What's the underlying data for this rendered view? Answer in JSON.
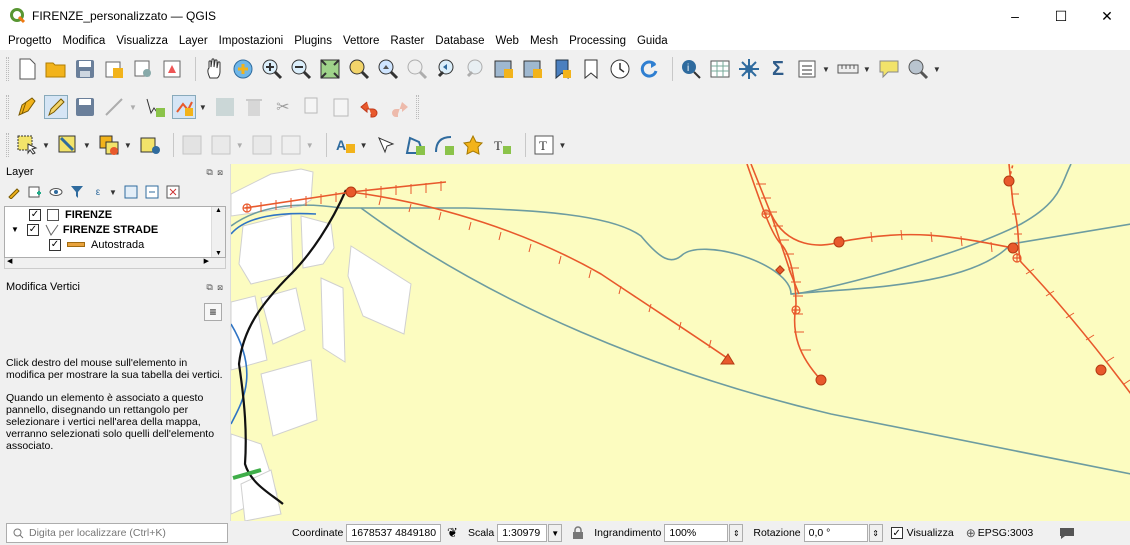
{
  "window": {
    "title": "FIRENZE_personalizzato — QGIS",
    "minimize": "–",
    "maximize": "☐",
    "close": "✕"
  },
  "menu": [
    "Progetto",
    "Modifica",
    "Visualizza",
    "Layer",
    "Impostazioni",
    "Plugins",
    "Vettore",
    "Raster",
    "Database",
    "Web",
    "Mesh",
    "Processing",
    "Guida"
  ],
  "layers_panel": {
    "title": "Layer",
    "layers": [
      {
        "name": "FIRENZE",
        "checked": true
      },
      {
        "name": "FIRENZE STRADE",
        "checked": true
      },
      {
        "name": "Autostrada",
        "checked": true
      }
    ]
  },
  "vertex_panel": {
    "title": "Modifica Vertici",
    "paragraph1": "Click destro del mouse sull'elemento in modifica per mostrare la sua tabella dei vertici.",
    "paragraph2": "Quando un elemento è associato a questo pannello, disegnando un rettangolo per selezionare i vertici nell'area della mappa, verranno selezionati solo quelli dell'elemento associato."
  },
  "status": {
    "locator_placeholder": "Digita per localizzare (Ctrl+K)",
    "coord_label": "Coordinate",
    "coord_value": "1678537 4849180",
    "scale_label": "Scala",
    "scale_value": "1:30979",
    "magnifier_label": "Ingrandimento",
    "magnifier_value": "100%",
    "rotation_label": "Rotazione",
    "rotation_value": "0,0 °",
    "render_label": "Visualizza",
    "crs": "EPSG:3003"
  },
  "colors": {
    "map_background": "#fcfcc0",
    "railway": "#e8592c",
    "river": "#6d9ca0"
  }
}
